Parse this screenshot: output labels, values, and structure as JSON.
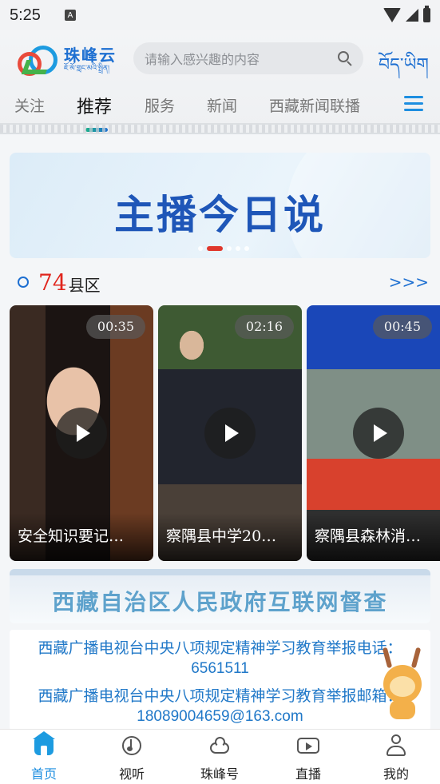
{
  "status_bar": {
    "time": "5:25",
    "notification": "A"
  },
  "header": {
    "logo_cn": "珠峰云",
    "logo_tibetan": "ཇོ་མོ་གླང་མའི་སྤྲིན།",
    "search_placeholder": "请输入感兴趣的内容",
    "language_switch": "བོད་ཡིག"
  },
  "tabs": [
    {
      "label": "关注"
    },
    {
      "label": "推荐",
      "active": true
    },
    {
      "label": "服务"
    },
    {
      "label": "新闻"
    },
    {
      "label": "西藏新闻联播"
    }
  ],
  "banner": {
    "title": "主播今日说",
    "slide_count": 5,
    "active_slide": 1
  },
  "section": {
    "count": "74",
    "label": "县区",
    "more": ">>>"
  },
  "videos": [
    {
      "duration": "00:35",
      "title": "安全知识要记…"
    },
    {
      "duration": "02:16",
      "title": "察隅县中学20…"
    },
    {
      "duration": "00:45",
      "title": "察隅县森林消…"
    }
  ],
  "supervise_banner": {
    "title": "西藏自治区人民政府互联网督查"
  },
  "report": {
    "line1": "西藏广播电视台中央八项规定精神学习教育举报电话：",
    "line2": "6561511",
    "line3": "西藏广播电视台中央八项规定精神学习教育举报邮箱：",
    "line4": "18089004659@163.com"
  },
  "bottom_nav": [
    {
      "label": "首页",
      "icon": "home-icon",
      "active": true
    },
    {
      "label": "视听",
      "icon": "music-note-icon"
    },
    {
      "label": "珠峰号",
      "icon": "cloud-icon"
    },
    {
      "label": "直播",
      "icon": "live-play-icon"
    },
    {
      "label": "我的",
      "icon": "person-icon"
    }
  ],
  "colors": {
    "accent": "#1d8ee0",
    "brand_blue": "#1d6fd1",
    "highlight_red": "#e0251d"
  }
}
